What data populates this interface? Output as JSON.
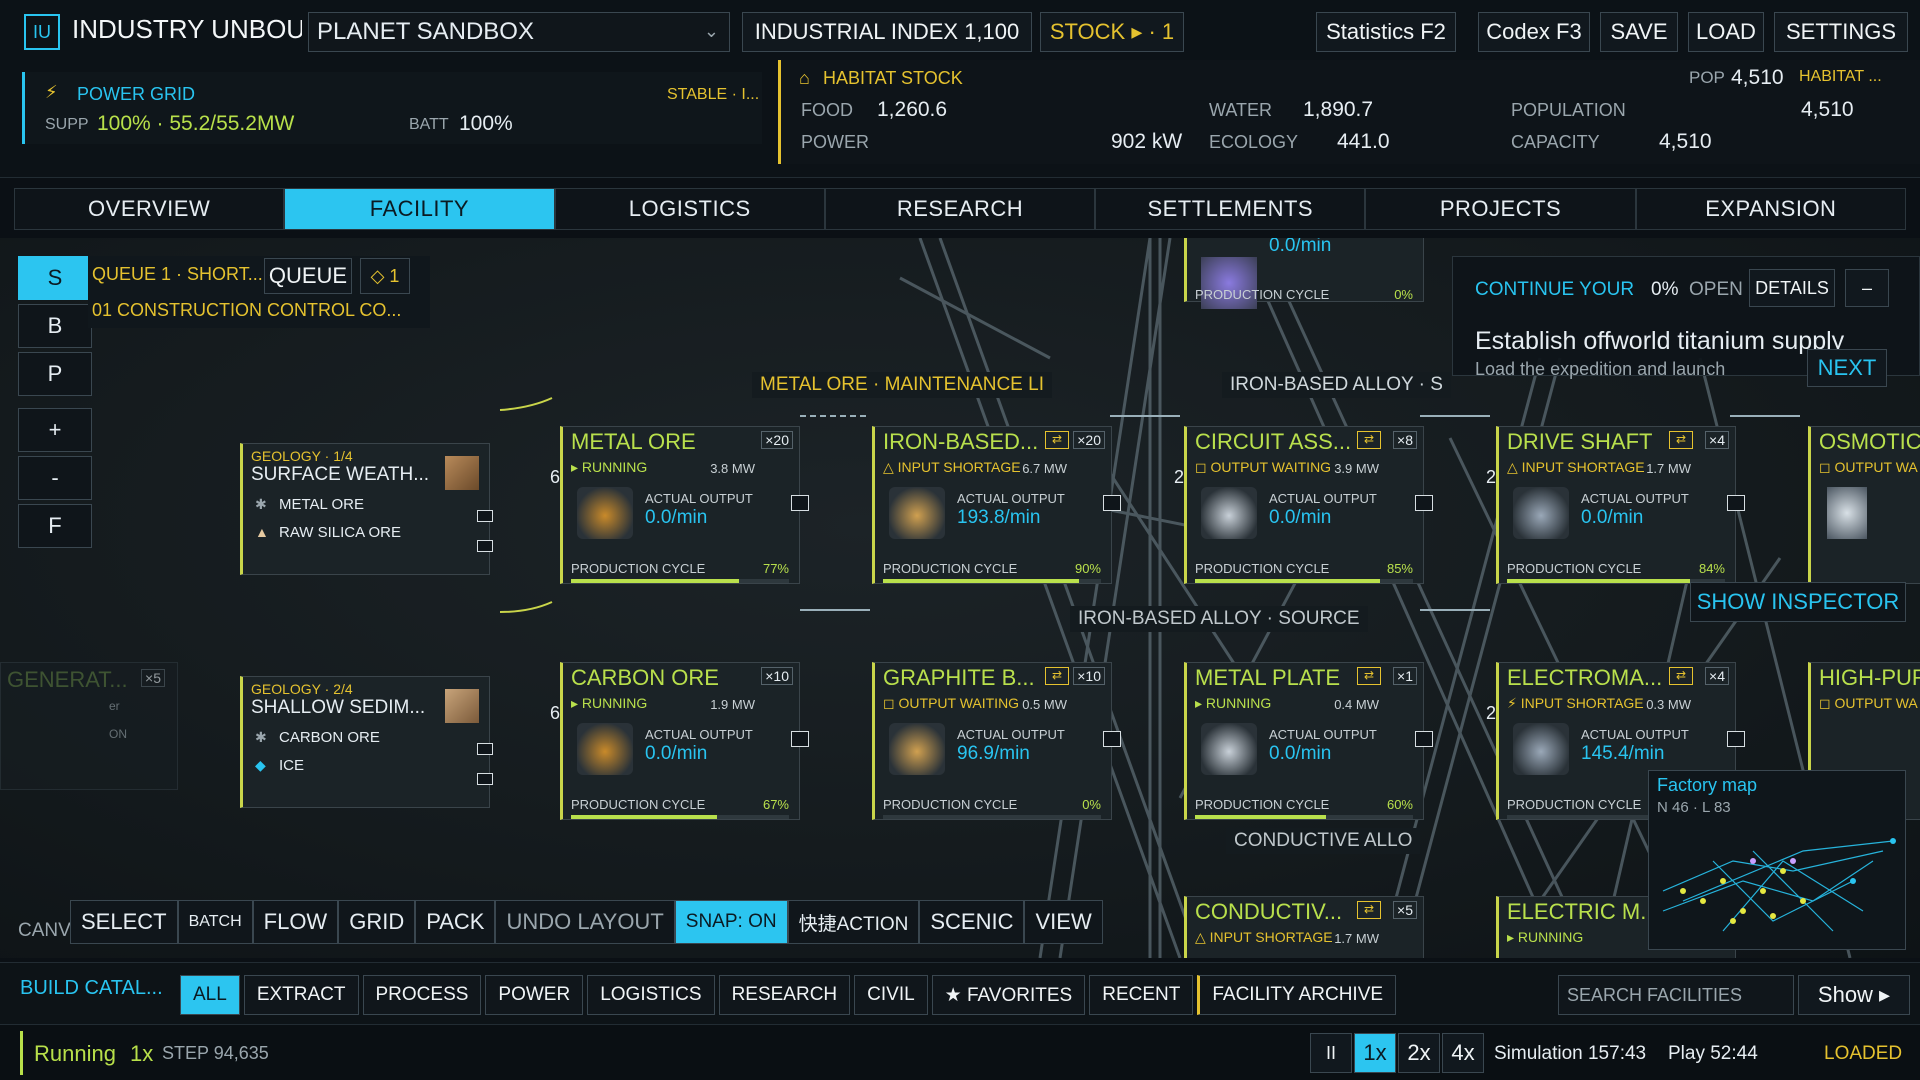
{
  "app": {
    "logo": "IU",
    "title": "INDUSTRY UNBOU",
    "world_select": "PLANET SANDBOX"
  },
  "header": {
    "index": "INDUSTRIAL INDEX 1,100",
    "stock": "STOCK ▸ · 1",
    "buttons": [
      "Statistics F2",
      "Codex F3",
      "SAVE",
      "LOAD",
      "SETTINGS"
    ]
  },
  "power": {
    "title": "POWER GRID",
    "state": "STABLE · I...",
    "supp_label": "SUPP",
    "supp_value": "100% · 55.2/55.2MW",
    "batt_label": "BATT",
    "batt_value": "100%"
  },
  "habitat": {
    "title": "HABITAT STOCK",
    "pop_label": "POP",
    "pop_value": "4,510",
    "pop_tag": "HABITAT ...",
    "food_label": "FOOD",
    "food": "1,260.6",
    "water_label": "WATER",
    "water": "1,890.7",
    "population_label": "POPULATION",
    "population": "4,510",
    "power_label": "POWER",
    "power": "902 kW",
    "ecology_label": "ECOLOGY",
    "ecology": "441.0",
    "capacity_label": "CAPACITY",
    "capacity": "4,510"
  },
  "tabs": [
    "OVERVIEW",
    "FACILITY",
    "LOGISTICS",
    "RESEARCH",
    "SETTLEMENTS",
    "PROJECTS",
    "EXPANSION"
  ],
  "active_tab": 1,
  "side_tools": [
    "S",
    "B",
    "P",
    "+",
    "-",
    "F"
  ],
  "queue": {
    "label": "QUEUE 1 · SHORT...",
    "button": "QUEUE",
    "badge": "◇ 1",
    "item": "01  CONSTRUCTION CONTROL CO..."
  },
  "flow_tags": {
    "metal": "METAL ORE · MAINTENANCE LI",
    "iron_top": "IRON-BASED ALLOY · S",
    "iron_mid": "IRON-BASED ALLOY · SOURCE",
    "conductive": "CONDUCTIVE ALLO"
  },
  "geology": [
    {
      "tag": "GEOLOGY · 1/4",
      "name": "SURFACE WEATH...",
      "outputs": [
        "METAL ORE",
        "RAW SILICA ORE"
      ]
    },
    {
      "tag": "GEOLOGY · 2/4",
      "name": "SHALLOW SEDIM...",
      "outputs": [
        "CARBON ORE",
        "ICE"
      ]
    }
  ],
  "labels": {
    "actual_output": "ACTUAL OUTPUT",
    "production_cycle": "PRODUCTION CYCLE"
  },
  "nodes": [
    {
      "name": "METAL ORE",
      "count": "×20",
      "status": "▸ RUNNING",
      "status_color": "#b9e04c",
      "mw": "3.8 MW",
      "output": "0.0/min",
      "cycle": "77%",
      "progress": 0.77,
      "col": 0,
      "row": 0,
      "side": "6"
    },
    {
      "name": "IRON-BASED...",
      "count": "×20",
      "status": "△ INPUT SHORTAGE",
      "status_color": "#e5c22f",
      "mw": "6.7 MW",
      "output": "193.8/min",
      "cycle": "90%",
      "progress": 0.9,
      "col": 1,
      "row": 0,
      "swap": true
    },
    {
      "name": "CIRCUIT ASS...",
      "count": "×8",
      "status": "◻ OUTPUT WAITING",
      "status_color": "#e5c22f",
      "mw": "3.9 MW",
      "output": "0.0/min",
      "cycle": "85%",
      "progress": 0.85,
      "col": 2,
      "row": 0,
      "swap": true,
      "side": "2"
    },
    {
      "name": "DRIVE SHAFT",
      "count": "×4",
      "status": "△ INPUT SHORTAGE",
      "status_color": "#e5c22f",
      "mw": "1.7 MW",
      "output": "0.0/min",
      "cycle": "84%",
      "progress": 0.84,
      "col": 3,
      "row": 0,
      "swap": true,
      "side": "2"
    },
    {
      "name": "CARBON ORE",
      "count": "×10",
      "status": "▸ RUNNING",
      "status_color": "#b9e04c",
      "mw": "1.9 MW",
      "output": "0.0/min",
      "cycle": "67%",
      "progress": 0.67,
      "col": 0,
      "row": 1,
      "side": "6"
    },
    {
      "name": "GRAPHITE B...",
      "count": "×10",
      "status": "◻ OUTPUT WAITING",
      "status_color": "#e5c22f",
      "mw": "0.5 MW",
      "output": "96.9/min",
      "cycle": "0%",
      "progress": 0.0,
      "col": 1,
      "row": 1,
      "swap": true
    },
    {
      "name": "METAL PLATE",
      "count": "×1",
      "status": "▸ RUNNING",
      "status_color": "#b9e04c",
      "mw": "0.4 MW",
      "output": "0.0/min",
      "cycle": "60%",
      "progress": 0.6,
      "col": 2,
      "row": 1,
      "swap": true
    },
    {
      "name": "ELECTROMA...",
      "count": "×4",
      "status": "⚡ INPUT SHORTAGE",
      "status_color": "#e5c22f",
      "mw": "0.3 MW",
      "output": "145.4/min",
      "cycle": "",
      "progress": 0.0,
      "col": 3,
      "row": 1,
      "swap": true,
      "side": "2"
    }
  ],
  "partial_nodes": {
    "osmotic": "OSMOTIC",
    "osmotic_status": "◻ OUTPUT WA",
    "high_pur": "HIGH-PUR",
    "high_pur_status": "◻ OUTPUT WA",
    "conductiv": "CONDUCTIV...",
    "conductiv_count": "×5",
    "conductiv_status": "△ INPUT SHORTAGE",
    "conductiv_mw": "1.7 MW",
    "electric": "ELECTRIC M...",
    "electric_status": "▸ RUNNING",
    "top_output": "0.0/min",
    "top_cycle": "0%"
  },
  "left_partial": {
    "name": "GENERAT...",
    "count": "×5",
    "sub1": "er",
    "sub2": "ON"
  },
  "objective": {
    "label": "CONTINUE YOUR",
    "pct": "0%",
    "open": "OPEN",
    "details": "DETAILS",
    "minus": "–",
    "title": "Establish offworld titanium supply",
    "desc": "Load the expedition and launch",
    "next": "NEXT"
  },
  "inspector": "SHOW INSPECTOR",
  "factory_map": {
    "title": "Factory map",
    "sub": "N 46 · L 83"
  },
  "canvas_label": "CANV",
  "tools": [
    "SELECT",
    "BATCH",
    "FLOW",
    "GRID",
    "PACK",
    "UNDO LAYOUT",
    "SNAP: ON",
    "快捷ACTION",
    "SCENIC",
    "VIEW"
  ],
  "catalog": {
    "title": "BUILD CATAL...",
    "filters": [
      "ALL",
      "EXTRACT",
      "PROCESS",
      "POWER",
      "LOGISTICS",
      "RESEARCH",
      "CIVIL",
      "★ FAVORITES",
      "RECENT",
      "FACILITY ARCHIVE"
    ],
    "search_placeholder": "SEARCH FACILITIES",
    "show": "Show ▸"
  },
  "status": {
    "running": "Running",
    "speed": "1x",
    "step": "STEP 94,635",
    "pause": "II",
    "speeds": [
      "1x",
      "2x",
      "4x"
    ],
    "sim": "Simulation 157:43",
    "play": "Play 52:44",
    "loaded": "LOADED"
  }
}
